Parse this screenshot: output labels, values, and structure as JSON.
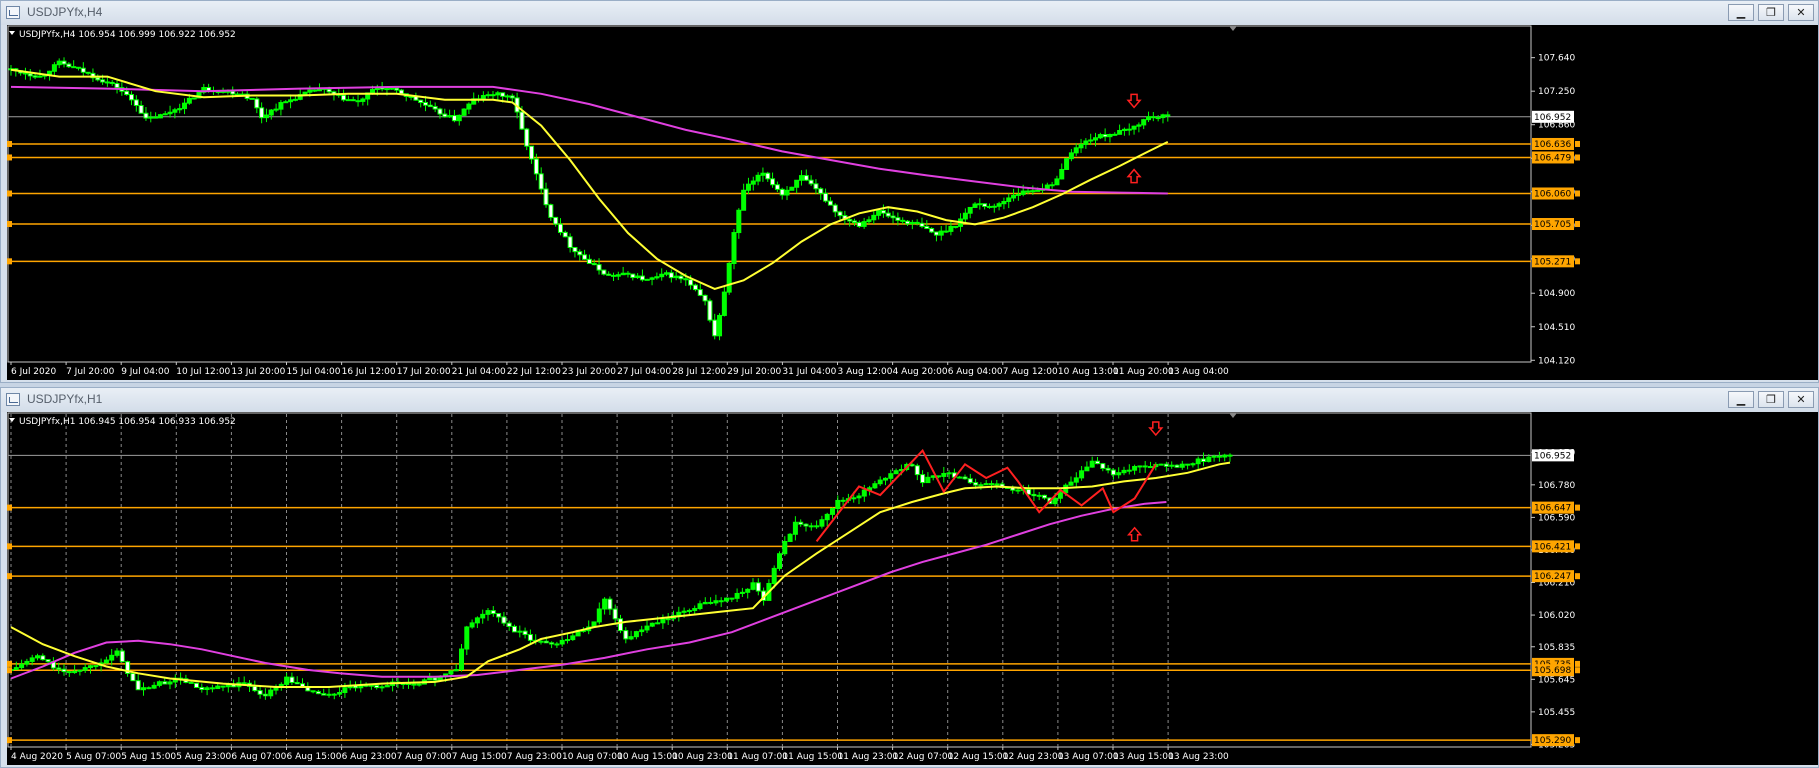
{
  "windows": [
    {
      "id": "h4",
      "title": "USDJPYfx,H4",
      "header": "USDJPYfx,H4  106.954 106.999 106.922 106.952",
      "buttons": [
        "▁",
        "❐",
        "✕"
      ]
    },
    {
      "id": "h1",
      "title": "USDJPYfx,H1",
      "header": "USDJPYfx,H1  106.945 106.954 106.933 106.952",
      "buttons": [
        "▁",
        "❐",
        "✕"
      ]
    }
  ],
  "colors": {
    "background": "#000000",
    "bull_candle": "#ffffff",
    "bear_candle": "#00ff00",
    "wick": "#00ff00",
    "ma_fast": "#ffff33",
    "ma_slow": "#e040e0",
    "level_line": "#ffa500",
    "price_line": "#9e9e9e",
    "zigzag": "#ff2020",
    "arrow": "#ff2020"
  },
  "chart_data": [
    {
      "type": "candlestick",
      "symbol": "USDJPYfx",
      "timeframe": "H4",
      "ylim": [
        104.1,
        107.95
      ],
      "y_ticks": [
        107.64,
        107.25,
        106.86,
        106.47,
        106.08,
        105.69,
        105.3,
        104.9,
        104.51,
        104.12
      ],
      "x_labels": [
        "6 Jul 2020",
        "7 Jul 20:00",
        "9 Jul 04:00",
        "10 Jul 12:00",
        "13 Jul 20:00",
        "15 Jul 04:00",
        "16 Jul 12:00",
        "17 Jul 20:00",
        "21 Jul 04:00",
        "22 Jul 12:00",
        "23 Jul 20:00",
        "27 Jul 04:00",
        "28 Jul 12:00",
        "29 Jul 20:00",
        "31 Jul 04:00",
        "3 Aug 12:00",
        "4 Aug 20:00",
        "6 Aug 04:00",
        "7 Aug 12:00",
        "10 Aug 13:00",
        "11 Aug 20:00",
        "13 Aug 04:00"
      ],
      "current_price": 106.952,
      "levels": [
        106.636,
        106.479,
        106.06,
        105.705,
        105.271
      ],
      "close_path": [
        [
          0,
          107.5
        ],
        [
          6,
          107.42
        ],
        [
          10,
          107.58
        ],
        [
          14,
          107.5
        ],
        [
          18,
          107.4
        ],
        [
          22,
          107.3
        ],
        [
          26,
          107.1
        ],
        [
          28,
          106.92
        ],
        [
          32,
          106.98
        ],
        [
          36,
          107.1
        ],
        [
          40,
          107.28
        ],
        [
          44,
          107.25
        ],
        [
          48,
          107.22
        ],
        [
          50,
          107.15
        ],
        [
          52,
          106.95
        ],
        [
          56,
          107.1
        ],
        [
          60,
          107.2
        ],
        [
          64,
          107.28
        ],
        [
          68,
          107.18
        ],
        [
          72,
          107.12
        ],
        [
          76,
          107.3
        ],
        [
          80,
          107.25
        ],
        [
          84,
          107.15
        ],
        [
          88,
          107.02
        ],
        [
          92,
          106.92
        ],
        [
          96,
          107.15
        ],
        [
          100,
          107.22
        ],
        [
          104,
          107.18
        ],
        [
          106,
          106.8
        ],
        [
          108,
          106.45
        ],
        [
          110,
          106.1
        ],
        [
          112,
          105.8
        ],
        [
          116,
          105.45
        ],
        [
          120,
          105.25
        ],
        [
          124,
          105.1
        ],
        [
          128,
          105.12
        ],
        [
          132,
          105.05
        ],
        [
          136,
          105.12
        ],
        [
          140,
          105.05
        ],
        [
          144,
          104.8
        ],
        [
          146,
          104.4
        ],
        [
          148,
          104.9
        ],
        [
          150,
          105.6
        ],
        [
          152,
          106.1
        ],
        [
          156,
          106.3
        ],
        [
          160,
          106.05
        ],
        [
          164,
          106.25
        ],
        [
          168,
          106.05
        ],
        [
          172,
          105.8
        ],
        [
          176,
          105.7
        ],
        [
          180,
          105.85
        ],
        [
          184,
          105.75
        ],
        [
          188,
          105.7
        ],
        [
          192,
          105.58
        ],
        [
          196,
          105.7
        ],
        [
          200,
          105.95
        ],
        [
          204,
          105.9
        ],
        [
          208,
          106.05
        ],
        [
          212,
          106.1
        ],
        [
          216,
          106.15
        ],
        [
          220,
          106.55
        ],
        [
          224,
          106.7
        ],
        [
          228,
          106.75
        ],
        [
          232,
          106.8
        ],
        [
          236,
          106.95
        ],
        [
          240,
          106.952
        ]
      ],
      "ma_fast": [
        [
          0,
          107.5
        ],
        [
          10,
          107.42
        ],
        [
          20,
          107.42
        ],
        [
          30,
          107.25
        ],
        [
          40,
          107.18
        ],
        [
          50,
          107.2
        ],
        [
          60,
          107.2
        ],
        [
          70,
          107.22
        ],
        [
          80,
          107.22
        ],
        [
          90,
          107.15
        ],
        [
          100,
          107.15
        ],
        [
          104,
          107.12
        ],
        [
          110,
          106.85
        ],
        [
          116,
          106.45
        ],
        [
          122,
          106.0
        ],
        [
          128,
          105.6
        ],
        [
          134,
          105.3
        ],
        [
          140,
          105.1
        ],
        [
          146,
          104.95
        ],
        [
          152,
          105.05
        ],
        [
          158,
          105.25
        ],
        [
          164,
          105.5
        ],
        [
          170,
          105.7
        ],
        [
          176,
          105.83
        ],
        [
          182,
          105.9
        ],
        [
          188,
          105.85
        ],
        [
          194,
          105.75
        ],
        [
          200,
          105.7
        ],
        [
          206,
          105.78
        ],
        [
          212,
          105.9
        ],
        [
          218,
          106.05
        ],
        [
          224,
          106.22
        ],
        [
          230,
          106.38
        ],
        [
          236,
          106.55
        ],
        [
          240,
          106.66
        ]
      ],
      "ma_slow": [
        [
          0,
          107.3
        ],
        [
          20,
          107.28
        ],
        [
          40,
          107.25
        ],
        [
          60,
          107.28
        ],
        [
          80,
          107.3
        ],
        [
          100,
          107.3
        ],
        [
          110,
          107.22
        ],
        [
          120,
          107.1
        ],
        [
          130,
          106.95
        ],
        [
          140,
          106.8
        ],
        [
          150,
          106.68
        ],
        [
          160,
          106.55
        ],
        [
          170,
          106.45
        ],
        [
          180,
          106.35
        ],
        [
          190,
          106.27
        ],
        [
          200,
          106.2
        ],
        [
          210,
          106.13
        ],
        [
          220,
          106.08
        ],
        [
          230,
          106.07
        ],
        [
          240,
          106.06
        ]
      ],
      "arrows": [
        {
          "x": 233,
          "y": 107.12,
          "dir": "down"
        },
        {
          "x": 233,
          "y": 106.28,
          "dir": "up"
        }
      ]
    },
    {
      "type": "candlestick",
      "symbol": "USDJPYfx",
      "timeframe": "H1",
      "ylim": [
        105.25,
        107.17
      ],
      "y_ticks": [
        106.97,
        106.78,
        106.59,
        106.4,
        106.21,
        106.02,
        105.835,
        105.645,
        105.455,
        105.265
      ],
      "x_labels": [
        "4 Aug 2020",
        "5 Aug 07:00",
        "5 Aug 15:00",
        "5 Aug 23:00",
        "6 Aug 07:00",
        "6 Aug 15:00",
        "6 Aug 23:00",
        "7 Aug 07:00",
        "7 Aug 15:00",
        "7 Aug 23:00",
        "10 Aug 07:00",
        "10 Aug 15:00",
        "10 Aug 23:00",
        "11 Aug 07:00",
        "11 Aug 15:00",
        "11 Aug 23:00",
        "12 Aug 07:00",
        "12 Aug 15:00",
        "12 Aug 23:00",
        "13 Aug 07:00",
        "13 Aug 15:00",
        "13 Aug 23:00"
      ],
      "current_price": 106.952,
      "levels": [
        106.647,
        106.421,
        106.247,
        105.735,
        105.698,
        105.29
      ],
      "close_path": [
        [
          0,
          105.7
        ],
        [
          5,
          105.78
        ],
        [
          10,
          105.68
        ],
        [
          15,
          105.72
        ],
        [
          20,
          105.8
        ],
        [
          24,
          105.58
        ],
        [
          28,
          105.62
        ],
        [
          32,
          105.65
        ],
        [
          36,
          105.58
        ],
        [
          40,
          105.6
        ],
        [
          44,
          105.62
        ],
        [
          48,
          105.55
        ],
        [
          52,
          105.65
        ],
        [
          56,
          105.58
        ],
        [
          60,
          105.55
        ],
        [
          64,
          105.6
        ],
        [
          68,
          105.6
        ],
        [
          72,
          105.62
        ],
        [
          76,
          105.62
        ],
        [
          80,
          105.65
        ],
        [
          84,
          105.7
        ],
        [
          86,
          105.95
        ],
        [
          90,
          106.05
        ],
        [
          94,
          105.95
        ],
        [
          98,
          105.88
        ],
        [
          102,
          105.85
        ],
        [
          106,
          105.9
        ],
        [
          110,
          105.98
        ],
        [
          112,
          106.12
        ],
        [
          116,
          105.88
        ],
        [
          120,
          105.95
        ],
        [
          124,
          106.0
        ],
        [
          128,
          106.05
        ],
        [
          132,
          106.1
        ],
        [
          136,
          106.12
        ],
        [
          140,
          106.2
        ],
        [
          142,
          106.1
        ],
        [
          144,
          106.3
        ],
        [
          146,
          106.45
        ],
        [
          148,
          106.55
        ],
        [
          152,
          106.55
        ],
        [
          156,
          106.68
        ],
        [
          160,
          106.72
        ],
        [
          164,
          106.8
        ],
        [
          166,
          106.85
        ],
        [
          170,
          106.9
        ],
        [
          172,
          106.8
        ],
        [
          176,
          106.85
        ],
        [
          180,
          106.82
        ],
        [
          182,
          106.78
        ],
        [
          186,
          106.78
        ],
        [
          190,
          106.75
        ],
        [
          194,
          106.72
        ],
        [
          196,
          106.68
        ],
        [
          200,
          106.8
        ],
        [
          204,
          106.92
        ],
        [
          208,
          106.85
        ],
        [
          212,
          106.88
        ],
        [
          216,
          106.9
        ],
        [
          220,
          106.88
        ],
        [
          224,
          106.92
        ],
        [
          228,
          106.95
        ],
        [
          230,
          106.952
        ]
      ],
      "ma_fast": [
        [
          0,
          105.95
        ],
        [
          6,
          105.85
        ],
        [
          12,
          105.78
        ],
        [
          18,
          105.72
        ],
        [
          24,
          105.68
        ],
        [
          30,
          105.65
        ],
        [
          40,
          105.62
        ],
        [
          50,
          105.6
        ],
        [
          60,
          105.6
        ],
        [
          70,
          105.62
        ],
        [
          80,
          105.63
        ],
        [
          86,
          105.66
        ],
        [
          90,
          105.75
        ],
        [
          96,
          105.82
        ],
        [
          100,
          105.88
        ],
        [
          106,
          105.92
        ],
        [
          110,
          105.95
        ],
        [
          116,
          105.98
        ],
        [
          122,
          106.0
        ],
        [
          128,
          106.02
        ],
        [
          134,
          106.04
        ],
        [
          140,
          106.06
        ],
        [
          146,
          106.25
        ],
        [
          152,
          106.38
        ],
        [
          158,
          106.5
        ],
        [
          164,
          106.62
        ],
        [
          170,
          106.68
        ],
        [
          176,
          106.73
        ],
        [
          180,
          106.76
        ],
        [
          186,
          106.77
        ],
        [
          192,
          106.76
        ],
        [
          198,
          106.76
        ],
        [
          204,
          106.77
        ],
        [
          210,
          106.8
        ],
        [
          216,
          106.82
        ],
        [
          222,
          106.85
        ],
        [
          228,
          106.9
        ],
        [
          230,
          106.91
        ]
      ],
      "ma_slow": [
        [
          0,
          105.65
        ],
        [
          6,
          105.72
        ],
        [
          12,
          105.8
        ],
        [
          18,
          105.86
        ],
        [
          24,
          105.87
        ],
        [
          30,
          105.85
        ],
        [
          36,
          105.82
        ],
        [
          42,
          105.78
        ],
        [
          48,
          105.74
        ],
        [
          56,
          105.7
        ],
        [
          62,
          105.68
        ],
        [
          70,
          105.66
        ],
        [
          80,
          105.66
        ],
        [
          88,
          105.67
        ],
        [
          96,
          105.7
        ],
        [
          104,
          105.73
        ],
        [
          112,
          105.77
        ],
        [
          120,
          105.82
        ],
        [
          128,
          105.86
        ],
        [
          136,
          105.92
        ],
        [
          142,
          105.99
        ],
        [
          148,
          106.06
        ],
        [
          154,
          106.13
        ],
        [
          160,
          106.2
        ],
        [
          166,
          106.27
        ],
        [
          172,
          106.33
        ],
        [
          178,
          106.38
        ],
        [
          184,
          106.43
        ],
        [
          190,
          106.49
        ],
        [
          196,
          106.55
        ],
        [
          202,
          106.6
        ],
        [
          208,
          106.64
        ],
        [
          214,
          106.67
        ],
        [
          218,
          106.68
        ]
      ],
      "zigzag": [
        [
          152,
          106.45
        ],
        [
          160,
          106.77
        ],
        [
          164,
          106.72
        ],
        [
          172,
          106.98
        ],
        [
          176,
          106.74
        ],
        [
          180,
          106.9
        ],
        [
          184,
          106.82
        ],
        [
          188,
          106.88
        ],
        [
          190,
          106.8
        ],
        [
          194,
          106.62
        ],
        [
          198,
          106.75
        ],
        [
          202,
          106.66
        ],
        [
          206,
          106.76
        ],
        [
          208,
          106.62
        ],
        [
          212,
          106.7
        ],
        [
          216,
          106.9
        ]
      ],
      "arrows": [
        {
          "x": 216,
          "y": 107.1,
          "dir": "down"
        },
        {
          "x": 212,
          "y": 106.5,
          "dir": "up"
        }
      ]
    }
  ]
}
